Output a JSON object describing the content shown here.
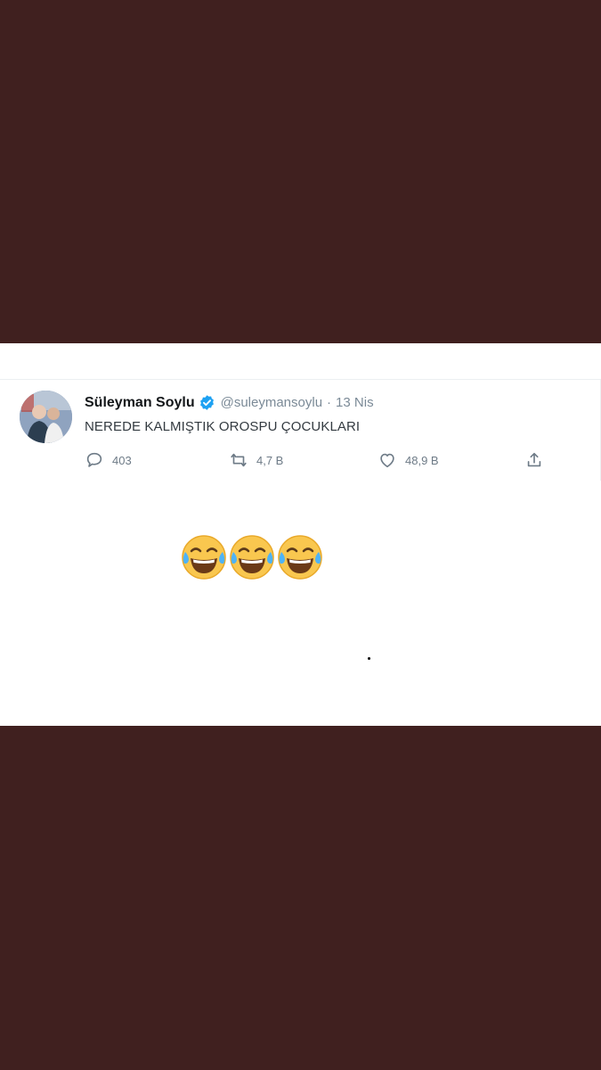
{
  "tweet": {
    "display_name": "Süleyman Soylu",
    "handle": "@suleymansoylu",
    "separator": "·",
    "date": "13 Nis",
    "text": "NEREDE KALMIŞTIK OROSPU ÇOCUKLARI",
    "actions": {
      "replies": "403",
      "retweets": "4,7 B",
      "likes": "48,9 B"
    },
    "icons": {
      "verified": "verified-badge-icon",
      "reply": "comment-bubble-icon",
      "retweet": "retweet-arrows-icon",
      "like": "heart-icon",
      "share": "share-upload-icon"
    }
  },
  "emojis": [
    "😂",
    "😂",
    "😂"
  ],
  "colors": {
    "background": "#40201f",
    "panel": "#ffffff",
    "verified": "#1da1f2",
    "muted_text": "#7b8a97"
  }
}
